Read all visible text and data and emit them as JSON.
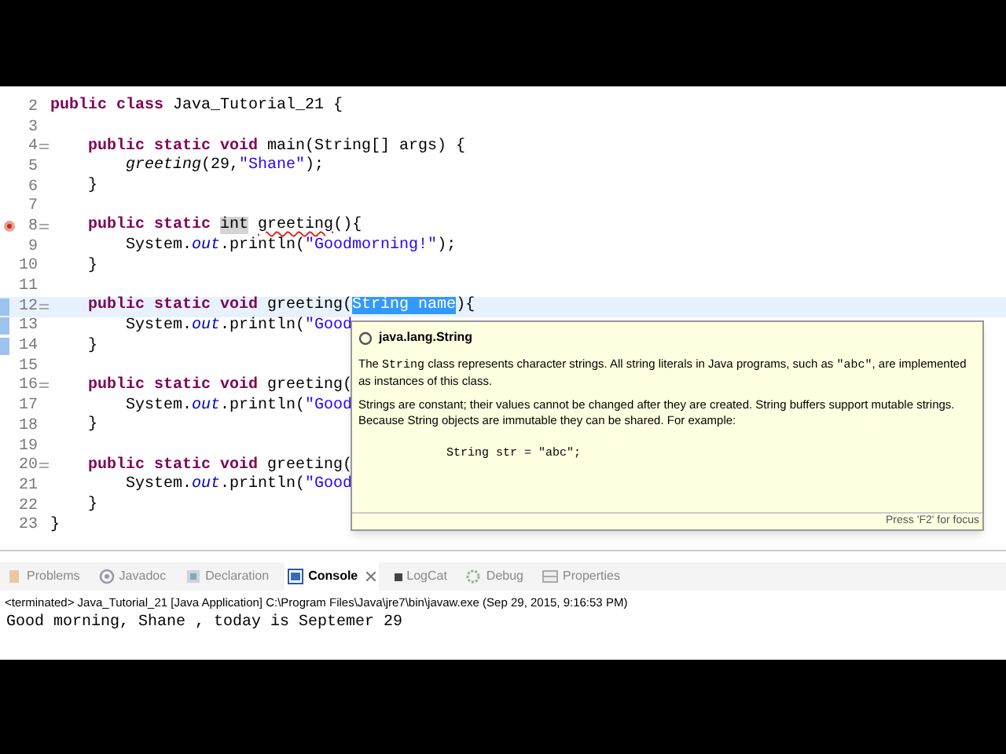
{
  "editor": {
    "lines": [
      {
        "number": "2",
        "fold": false,
        "error": false,
        "current": false,
        "changed": false,
        "tokens": [
          {
            "kind": "kw",
            "text": "public class"
          },
          {
            "kind": "plain",
            "text": " Java_Tutorial_21 {"
          }
        ]
      },
      {
        "number": "3",
        "fold": false,
        "error": false,
        "current": false,
        "changed": false
      },
      {
        "number": "4",
        "fold": true,
        "error": false,
        "current": false,
        "changed": false,
        "tokens": [
          {
            "kind": "kw",
            "text": "    public static void"
          },
          {
            "kind": "plain",
            "text": " main(String[] args) {"
          }
        ]
      },
      {
        "number": "5",
        "fold": false,
        "error": false,
        "current": false,
        "changed": false,
        "tokens": [
          {
            "kind": "call",
            "text": "        greeting"
          },
          {
            "kind": "plain",
            "text": "(29,"
          },
          {
            "kind": "string",
            "text": "\"Shane\""
          },
          {
            "kind": "plain",
            "text": ");"
          }
        ]
      },
      {
        "number": "6",
        "fold": false,
        "error": false,
        "current": false,
        "changed": false,
        "tokens": [
          {
            "kind": "plain",
            "text": "    }"
          }
        ]
      },
      {
        "number": "7",
        "fold": false,
        "error": false,
        "current": false,
        "changed": false
      },
      {
        "number": "8",
        "fold": true,
        "error": true,
        "current": false,
        "changed": false,
        "tokens": [
          {
            "kind": "kw",
            "text": "    public static "
          },
          {
            "kind": "occurrence",
            "text": "int"
          },
          {
            "kind": "error",
            "text": "greeting"
          },
          {
            "kind": "plain",
            "text": "(){"
          }
        ]
      },
      {
        "number": "9",
        "fold": false,
        "error": false,
        "current": false,
        "changed": false,
        "tokens": [
          {
            "kind": "plain",
            "text": "        System."
          },
          {
            "kind": "field",
            "text": "out"
          },
          {
            "kind": "plain",
            "text": ".println("
          },
          {
            "kind": "string",
            "text": "\"Goodmorning!\""
          },
          {
            "kind": "plain",
            "text": ");"
          }
        ]
      },
      {
        "number": "10",
        "fold": false,
        "error": false,
        "current": false,
        "changed": false,
        "tokens": [
          {
            "kind": "plain",
            "text": "    }"
          }
        ]
      },
      {
        "number": "11",
        "fold": false,
        "error": false,
        "current": false,
        "changed": false
      },
      {
        "number": "12",
        "fold": true,
        "error": false,
        "current": true,
        "changed": true,
        "tokens": [
          {
            "kind": "kw",
            "text": "    public static void"
          },
          {
            "kind": "plain",
            "text": " greeting("
          },
          {
            "kind": "selected",
            "text": "String name"
          },
          {
            "kind": "plain",
            "text": "){"
          }
        ]
      },
      {
        "number": "13",
        "fold": false,
        "error": false,
        "current": false,
        "changed": true,
        "tokens": [
          {
            "kind": "plain",
            "text": "        System."
          },
          {
            "kind": "field",
            "text": "out"
          },
          {
            "kind": "plain",
            "text": ".println("
          },
          {
            "kind": "string",
            "text": "\"Good"
          }
        ]
      },
      {
        "number": "14",
        "fold": false,
        "error": false,
        "current": false,
        "changed": true,
        "tokens": [
          {
            "kind": "plain",
            "text": "    }"
          }
        ]
      },
      {
        "number": "15",
        "fold": false,
        "error": false,
        "current": false,
        "changed": false
      },
      {
        "number": "16",
        "fold": true,
        "error": false,
        "current": false,
        "changed": false,
        "tokens": [
          {
            "kind": "kw",
            "text": "    public static void"
          },
          {
            "kind": "plain",
            "text": " greeting("
          }
        ]
      },
      {
        "number": "17",
        "fold": false,
        "error": false,
        "current": false,
        "changed": false,
        "tokens": [
          {
            "kind": "plain",
            "text": "        System."
          },
          {
            "kind": "field",
            "text": "out"
          },
          {
            "kind": "plain",
            "text": ".println("
          },
          {
            "kind": "string",
            "text": "\"Good"
          }
        ]
      },
      {
        "number": "18",
        "fold": false,
        "error": false,
        "current": false,
        "changed": false,
        "tokens": [
          {
            "kind": "plain",
            "text": "    }"
          }
        ]
      },
      {
        "number": "19",
        "fold": false,
        "error": false,
        "current": false,
        "changed": false
      },
      {
        "number": "20",
        "fold": true,
        "error": false,
        "current": false,
        "changed": false,
        "tokens": [
          {
            "kind": "kw",
            "text": "    public static void"
          },
          {
            "kind": "plain",
            "text": " greeting("
          }
        ]
      },
      {
        "number": "21",
        "fold": false,
        "error": false,
        "current": false,
        "changed": false,
        "tokens": [
          {
            "kind": "plain",
            "text": "        System."
          },
          {
            "kind": "field",
            "text": "out"
          },
          {
            "kind": "plain",
            "text": ".println("
          },
          {
            "kind": "string",
            "text": "\"Good"
          }
        ]
      },
      {
        "number": "22",
        "fold": false,
        "error": false,
        "current": false,
        "changed": false,
        "tokens": [
          {
            "kind": "plain",
            "text": "    }"
          }
        ]
      },
      {
        "number": "23",
        "fold": false,
        "error": false,
        "current": false,
        "changed": false,
        "tokens": [
          {
            "kind": "plain",
            "text": "}"
          }
        ]
      }
    ]
  },
  "hover": {
    "title": "java.lang.String",
    "paragraphs": [
      [
        {
          "kind": "text",
          "text": "The "
        },
        {
          "kind": "code",
          "text": "String"
        },
        {
          "kind": "text",
          "text": " class represents character strings. All string literals in Java programs, such as "
        },
        {
          "kind": "code",
          "text": "\"abc\""
        },
        {
          "kind": "text",
          "text": ", are implemented as instances of this class."
        }
      ],
      [
        {
          "kind": "text",
          "text": "Strings are constant; their values cannot be changed after they are created. String buffers support mutable strings. Because String objects are immutable they can be shared. For example:"
        }
      ]
    ],
    "example": "String str = \"abc\";",
    "footer": "Press 'F2' for focus"
  },
  "tabs": [
    {
      "kind": "problems",
      "label": "Problems",
      "selected": false
    },
    {
      "kind": "javadoc",
      "label": "Javadoc",
      "selected": false
    },
    {
      "kind": "declaration",
      "label": "Declaration",
      "selected": false
    },
    {
      "kind": "console",
      "label": "Console",
      "selected": true
    },
    {
      "kind": "logcat",
      "label": "LogCat",
      "selected": false
    },
    {
      "kind": "debug",
      "label": "Debug",
      "selected": false
    },
    {
      "kind": "properties",
      "label": "Properties",
      "selected": false
    }
  ],
  "console": {
    "header": "<terminated> Java_Tutorial_21 [Java Application] C:\\Program Files\\Java\\jre7\\bin\\javaw.exe (Sep 29, 2015, 9:16:53 PM)",
    "output": "Good morning, Shane , today is Septemer 29"
  }
}
